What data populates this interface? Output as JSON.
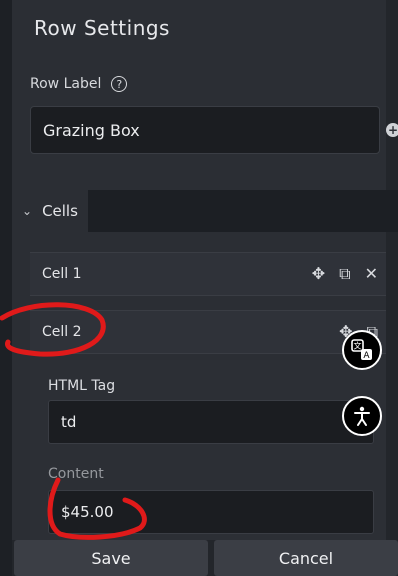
{
  "panel": {
    "title": "Row Settings",
    "row_label": "Row Label",
    "row_label_help": "?",
    "row_label_value": "Grazing Box",
    "cells_tab": "Cells"
  },
  "cells": [
    {
      "label": "Cell 1"
    },
    {
      "label": "Cell 2"
    }
  ],
  "cell2": {
    "html_tag_label": "HTML Tag",
    "html_tag_value": "td",
    "content_label": "Content",
    "content_value": "$45.00"
  },
  "footer": {
    "save_label": "Save",
    "cancel_label": "Cancel"
  },
  "colors": {
    "annotation": "#e01a1a",
    "panel_bg": "#2b2e34",
    "input_bg": "#1b1d21"
  }
}
